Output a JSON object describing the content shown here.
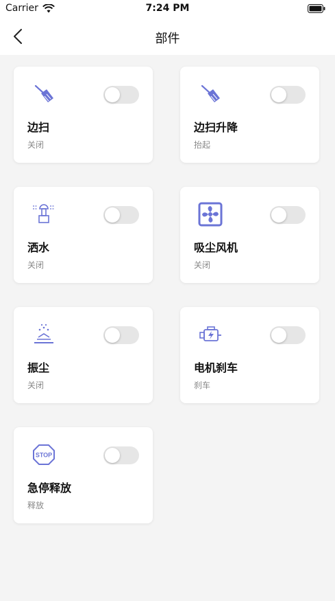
{
  "status_bar": {
    "carrier": "Carrier",
    "time": "7:24 PM"
  },
  "nav": {
    "title": "部件"
  },
  "colors": {
    "icon": "#6b74d6",
    "toggle_off": "#e6e6e6",
    "page_bg": "#f4f4f4"
  },
  "components": [
    {
      "name": "边扫",
      "state": "关闭",
      "icon": "broom-icon",
      "on": false
    },
    {
      "name": "边扫升降",
      "state": "抬起",
      "icon": "broom-icon",
      "on": false
    },
    {
      "name": "洒水",
      "state": "关闭",
      "icon": "sprinkler-icon",
      "on": false
    },
    {
      "name": "吸尘风机",
      "state": "关闭",
      "icon": "fan-icon",
      "on": false
    },
    {
      "name": "振尘",
      "state": "关闭",
      "icon": "dust-shake-icon",
      "on": false
    },
    {
      "name": "电机刹车",
      "state": "刹车",
      "icon": "motor-icon",
      "on": false
    },
    {
      "name": "急停释放",
      "state": "释放",
      "icon": "stop-sign-icon",
      "on": false
    }
  ]
}
